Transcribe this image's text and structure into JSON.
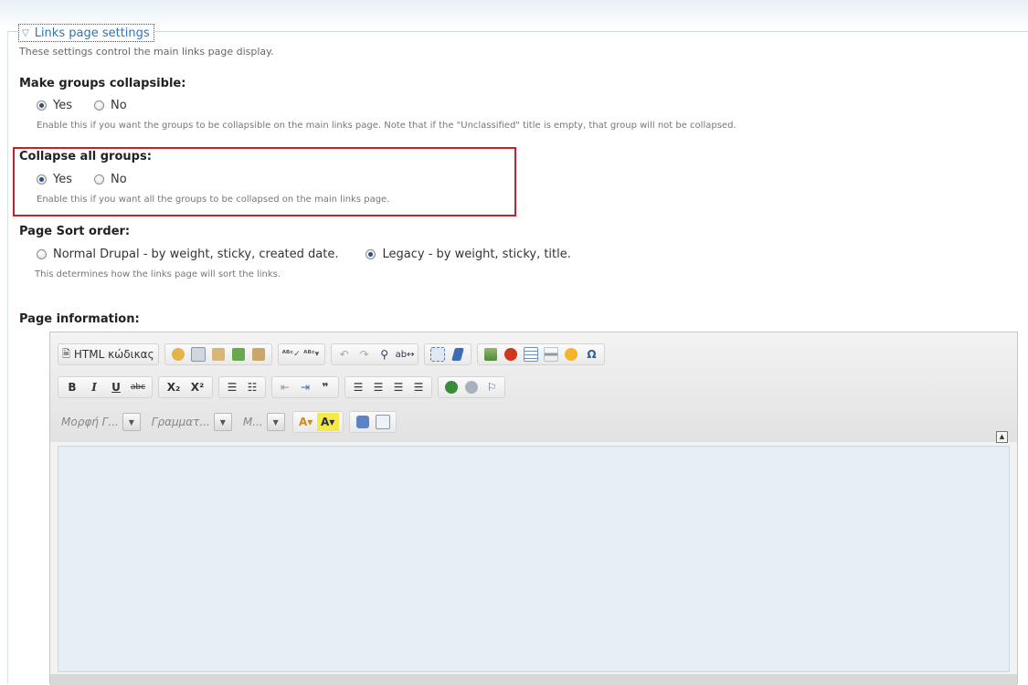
{
  "fieldset": {
    "legend": "Links page settings",
    "description": "These settings control the main links page display."
  },
  "collapsible": {
    "label": "Make groups collapsible:",
    "options": [
      "Yes",
      "No"
    ],
    "selected": "Yes",
    "description": "Enable this if you want the groups to be collapsible on the main links page. Note that if the \"Unclassified\" title is empty, that group will not be collapsed."
  },
  "collapse_all": {
    "label": "Collapse all groups:",
    "options": [
      "Yes",
      "No"
    ],
    "selected": "Yes",
    "description": "Enable this if you want all the groups to be collapsed on the main links page.",
    "highlight_color": "#c8202a"
  },
  "sort_order": {
    "label": "Page Sort order:",
    "options": [
      "Normal Drupal - by weight, sticky, created date.",
      "Legacy - by weight, sticky, title."
    ],
    "selected": "Legacy - by weight, sticky, title.",
    "description": "This determines how the links page will sort the links."
  },
  "page_info": {
    "label": "Page information:"
  },
  "editor": {
    "source_button": "HTML κώδικας",
    "format_combo": "Μορφή Γ...",
    "font_combo": "Γραμματ...",
    "size_combo": "Μ...",
    "icons_row1": [
      "cut-icon",
      "copy-icon",
      "paste-icon",
      "paste-text-icon",
      "paste-word-icon",
      "spellcheck-icon",
      "spellcheck-menu-icon",
      "undo-icon",
      "redo-icon",
      "find-icon",
      "replace-icon",
      "select-all-icon",
      "remove-format-icon",
      "image-icon",
      "flash-icon",
      "table-icon",
      "horizontal-rule-icon",
      "smiley-icon",
      "special-char-icon"
    ],
    "row2": {
      "bold": "B",
      "italic": "I",
      "underline": "U",
      "strike": "abc",
      "subscript": "X₂",
      "superscript": "X²",
      "blockquote": "❞"
    },
    "accent_color": "#2b75b8"
  }
}
